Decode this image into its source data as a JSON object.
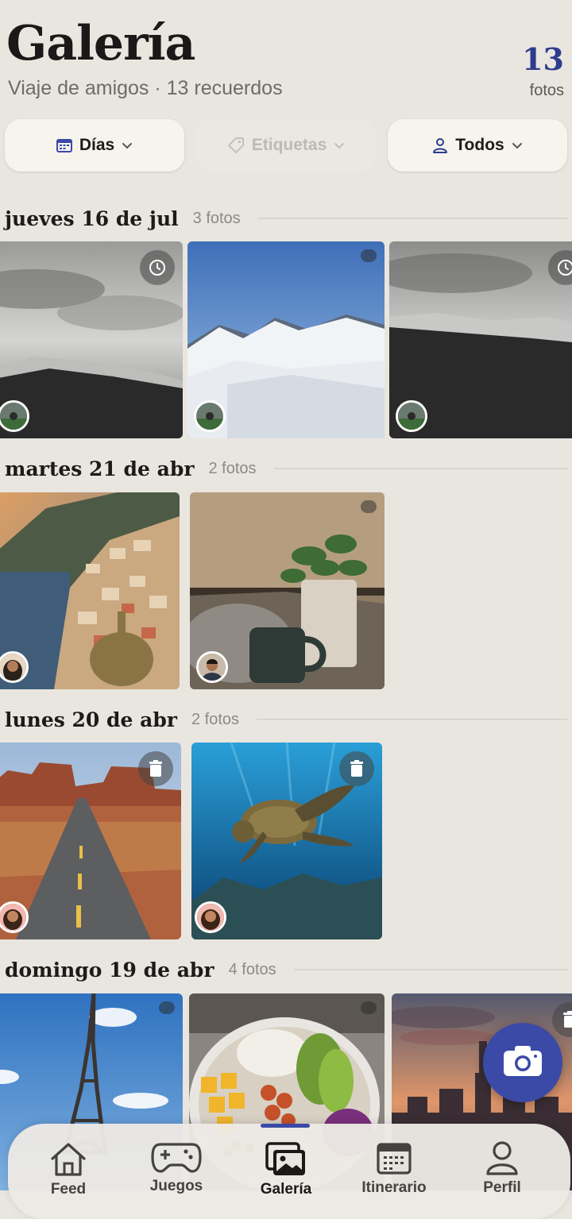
{
  "header": {
    "title": "Galería",
    "subtitle": "Viaje de amigos · 13 recuerdos",
    "photo_count": "13",
    "photo_count_label": "fotos"
  },
  "filters": {
    "days_label": "Días",
    "tags_label": "Etiquetas",
    "people_label": "Todos"
  },
  "sections": [
    {
      "title": "jueves 16 de jul",
      "count": "3 fotos"
    },
    {
      "title": "martes 21 de abr",
      "count": "2 fotos"
    },
    {
      "title": "lunes 20 de abr",
      "count": "2 fotos"
    },
    {
      "title": "domingo 19 de abr",
      "count": "4 fotos"
    }
  ],
  "tabs": [
    {
      "label": "Feed",
      "icon": "home-icon"
    },
    {
      "label": "Juegos",
      "icon": "gamepad-icon"
    },
    {
      "label": "Galería",
      "icon": "gallery-icon",
      "active": true
    },
    {
      "label": "Itinerario",
      "icon": "calendar-icon"
    },
    {
      "label": "Perfil",
      "icon": "person-icon"
    }
  ],
  "colors": {
    "accent": "#3b4aa6",
    "count_color": "#2d3d8c",
    "background": "#e9e6e0"
  }
}
